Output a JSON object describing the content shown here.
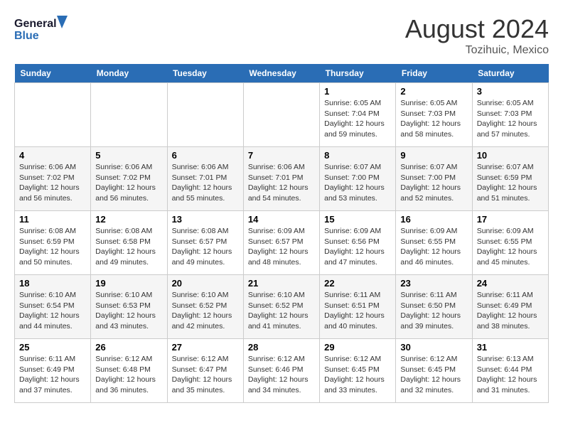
{
  "header": {
    "logo_line1": "General",
    "logo_line2": "Blue",
    "main_title": "August 2024",
    "subtitle": "Tozihuic, Mexico"
  },
  "weekdays": [
    "Sunday",
    "Monday",
    "Tuesday",
    "Wednesday",
    "Thursday",
    "Friday",
    "Saturday"
  ],
  "weeks": [
    [
      {
        "day": "",
        "info": ""
      },
      {
        "day": "",
        "info": ""
      },
      {
        "day": "",
        "info": ""
      },
      {
        "day": "",
        "info": ""
      },
      {
        "day": "1",
        "info": "Sunrise: 6:05 AM\nSunset: 7:04 PM\nDaylight: 12 hours\nand 59 minutes."
      },
      {
        "day": "2",
        "info": "Sunrise: 6:05 AM\nSunset: 7:03 PM\nDaylight: 12 hours\nand 58 minutes."
      },
      {
        "day": "3",
        "info": "Sunrise: 6:05 AM\nSunset: 7:03 PM\nDaylight: 12 hours\nand 57 minutes."
      }
    ],
    [
      {
        "day": "4",
        "info": "Sunrise: 6:06 AM\nSunset: 7:02 PM\nDaylight: 12 hours\nand 56 minutes."
      },
      {
        "day": "5",
        "info": "Sunrise: 6:06 AM\nSunset: 7:02 PM\nDaylight: 12 hours\nand 56 minutes."
      },
      {
        "day": "6",
        "info": "Sunrise: 6:06 AM\nSunset: 7:01 PM\nDaylight: 12 hours\nand 55 minutes."
      },
      {
        "day": "7",
        "info": "Sunrise: 6:06 AM\nSunset: 7:01 PM\nDaylight: 12 hours\nand 54 minutes."
      },
      {
        "day": "8",
        "info": "Sunrise: 6:07 AM\nSunset: 7:00 PM\nDaylight: 12 hours\nand 53 minutes."
      },
      {
        "day": "9",
        "info": "Sunrise: 6:07 AM\nSunset: 7:00 PM\nDaylight: 12 hours\nand 52 minutes."
      },
      {
        "day": "10",
        "info": "Sunrise: 6:07 AM\nSunset: 6:59 PM\nDaylight: 12 hours\nand 51 minutes."
      }
    ],
    [
      {
        "day": "11",
        "info": "Sunrise: 6:08 AM\nSunset: 6:59 PM\nDaylight: 12 hours\nand 50 minutes."
      },
      {
        "day": "12",
        "info": "Sunrise: 6:08 AM\nSunset: 6:58 PM\nDaylight: 12 hours\nand 49 minutes."
      },
      {
        "day": "13",
        "info": "Sunrise: 6:08 AM\nSunset: 6:57 PM\nDaylight: 12 hours\nand 49 minutes."
      },
      {
        "day": "14",
        "info": "Sunrise: 6:09 AM\nSunset: 6:57 PM\nDaylight: 12 hours\nand 48 minutes."
      },
      {
        "day": "15",
        "info": "Sunrise: 6:09 AM\nSunset: 6:56 PM\nDaylight: 12 hours\nand 47 minutes."
      },
      {
        "day": "16",
        "info": "Sunrise: 6:09 AM\nSunset: 6:55 PM\nDaylight: 12 hours\nand 46 minutes."
      },
      {
        "day": "17",
        "info": "Sunrise: 6:09 AM\nSunset: 6:55 PM\nDaylight: 12 hours\nand 45 minutes."
      }
    ],
    [
      {
        "day": "18",
        "info": "Sunrise: 6:10 AM\nSunset: 6:54 PM\nDaylight: 12 hours\nand 44 minutes."
      },
      {
        "day": "19",
        "info": "Sunrise: 6:10 AM\nSunset: 6:53 PM\nDaylight: 12 hours\nand 43 minutes."
      },
      {
        "day": "20",
        "info": "Sunrise: 6:10 AM\nSunset: 6:52 PM\nDaylight: 12 hours\nand 42 minutes."
      },
      {
        "day": "21",
        "info": "Sunrise: 6:10 AM\nSunset: 6:52 PM\nDaylight: 12 hours\nand 41 minutes."
      },
      {
        "day": "22",
        "info": "Sunrise: 6:11 AM\nSunset: 6:51 PM\nDaylight: 12 hours\nand 40 minutes."
      },
      {
        "day": "23",
        "info": "Sunrise: 6:11 AM\nSunset: 6:50 PM\nDaylight: 12 hours\nand 39 minutes."
      },
      {
        "day": "24",
        "info": "Sunrise: 6:11 AM\nSunset: 6:49 PM\nDaylight: 12 hours\nand 38 minutes."
      }
    ],
    [
      {
        "day": "25",
        "info": "Sunrise: 6:11 AM\nSunset: 6:49 PM\nDaylight: 12 hours\nand 37 minutes."
      },
      {
        "day": "26",
        "info": "Sunrise: 6:12 AM\nSunset: 6:48 PM\nDaylight: 12 hours\nand 36 minutes."
      },
      {
        "day": "27",
        "info": "Sunrise: 6:12 AM\nSunset: 6:47 PM\nDaylight: 12 hours\nand 35 minutes."
      },
      {
        "day": "28",
        "info": "Sunrise: 6:12 AM\nSunset: 6:46 PM\nDaylight: 12 hours\nand 34 minutes."
      },
      {
        "day": "29",
        "info": "Sunrise: 6:12 AM\nSunset: 6:45 PM\nDaylight: 12 hours\nand 33 minutes."
      },
      {
        "day": "30",
        "info": "Sunrise: 6:12 AM\nSunset: 6:45 PM\nDaylight: 12 hours\nand 32 minutes."
      },
      {
        "day": "31",
        "info": "Sunrise: 6:13 AM\nSunset: 6:44 PM\nDaylight: 12 hours\nand 31 minutes."
      }
    ]
  ]
}
